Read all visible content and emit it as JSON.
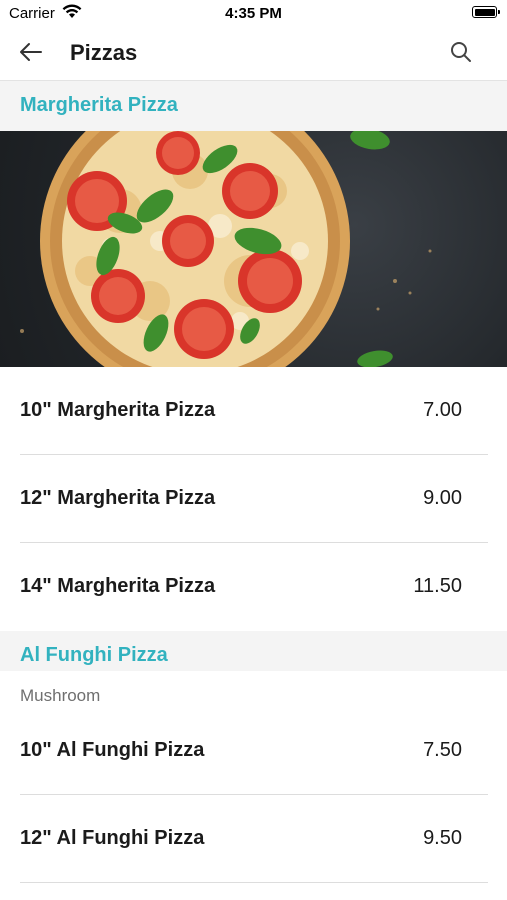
{
  "status_bar": {
    "carrier": "Carrier",
    "time": "4:35 PM"
  },
  "nav": {
    "title": "Pizzas",
    "back_icon": "arrow-left-icon",
    "search_icon": "search-icon"
  },
  "sections": [
    {
      "title": "Margherita Pizza",
      "image": "margherita-pizza-photo",
      "items": [
        {
          "name": "10\" Margherita Pizza",
          "price": "7.00"
        },
        {
          "name": "12\" Margherita Pizza",
          "price": "9.00"
        },
        {
          "name": "14\" Margherita Pizza",
          "price": "11.50"
        }
      ]
    },
    {
      "title": "Al Funghi Pizza",
      "subtitle": "Mushroom",
      "items": [
        {
          "name": "10\" Al Funghi Pizza",
          "price": "7.50"
        },
        {
          "name": "12\" Al Funghi Pizza",
          "price": "9.50"
        }
      ]
    }
  ],
  "colors": {
    "accent": "#32b2bf",
    "section_bg": "#f4f4f4",
    "divider": "#dddddd"
  }
}
